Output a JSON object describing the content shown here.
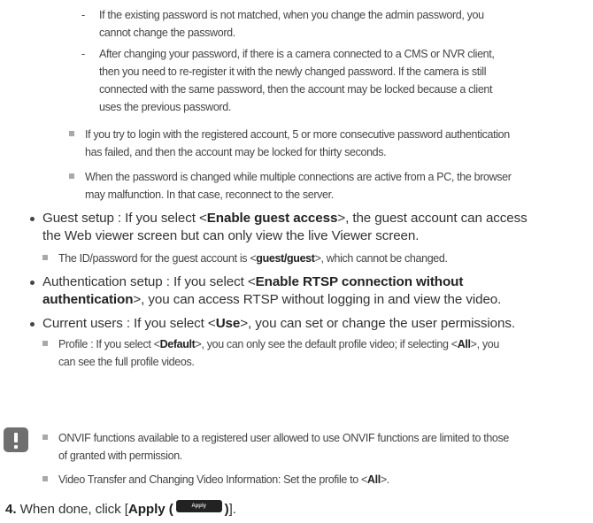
{
  "note1": {
    "dash_mark": "-",
    "line1": "If the existing password is not matched, when you change the admin password, you",
    "line2": "cannot change the password."
  },
  "note2": {
    "dash_mark": "-",
    "line1": "After changing your password, if there is a camera connected to a CMS or NVR client,",
    "line2": "then you need to re-register it with the newly changed password. If the camera is still",
    "line3": "connected with the same password, then the account may be locked because a client",
    "line4": "uses the previous password."
  },
  "note3": {
    "line1": "If you try to login with the registered account, 5 or more consecutive password authentication",
    "line2": "has failed, and then the account may be locked for thirty seconds."
  },
  "note4": {
    "line1": "When the password is changed while multiple connections are active from a PC, the browser",
    "line2": "may malfunction. In that case, reconnect to the server."
  },
  "guest": {
    "pre": "Guest setup : If you select <",
    "bold": "Enable guest access",
    "post": ">, the guest account can access",
    "line2": "the Web viewer screen but can only view the live Viewer screen.",
    "sub_pre": "The ID/password for the guest account is <",
    "sub_bold": "guest/guest",
    "sub_post": ">, which cannot be changed."
  },
  "auth": {
    "pre": "Authentication setup : If you select <",
    "bold1": "Enable RTSP connection without",
    "bold2": "authentication",
    "post": ">, you can access RTSP without logging in and view the video."
  },
  "users": {
    "pre": "Current users : If you select <",
    "bold": "Use",
    "post": ">, you can set or change the user permissions.",
    "sub_pre": "Profile : If you select <",
    "sub_bold1": "Default",
    "sub_mid": ">, you can only see the default profile video; if selecting <",
    "sub_bold2": "All",
    "sub_post": ">, you",
    "sub_line2": "can see the full profile videos."
  },
  "caution": {
    "item1_line1": "ONVIF functions available to a registered user allowed to use ONVIF functions are limited to those",
    "item1_line2": "of granted with permission.",
    "item2_pre": "Video Transfer and Changing Video Information: Set the profile to <",
    "item2_bold": "All",
    "item2_post": ">."
  },
  "step4": {
    "number": "4.",
    "pre": "When done, click [",
    "bold": "Apply (",
    "button_label": "Apply",
    "bold_close": ")",
    "post": "]."
  }
}
